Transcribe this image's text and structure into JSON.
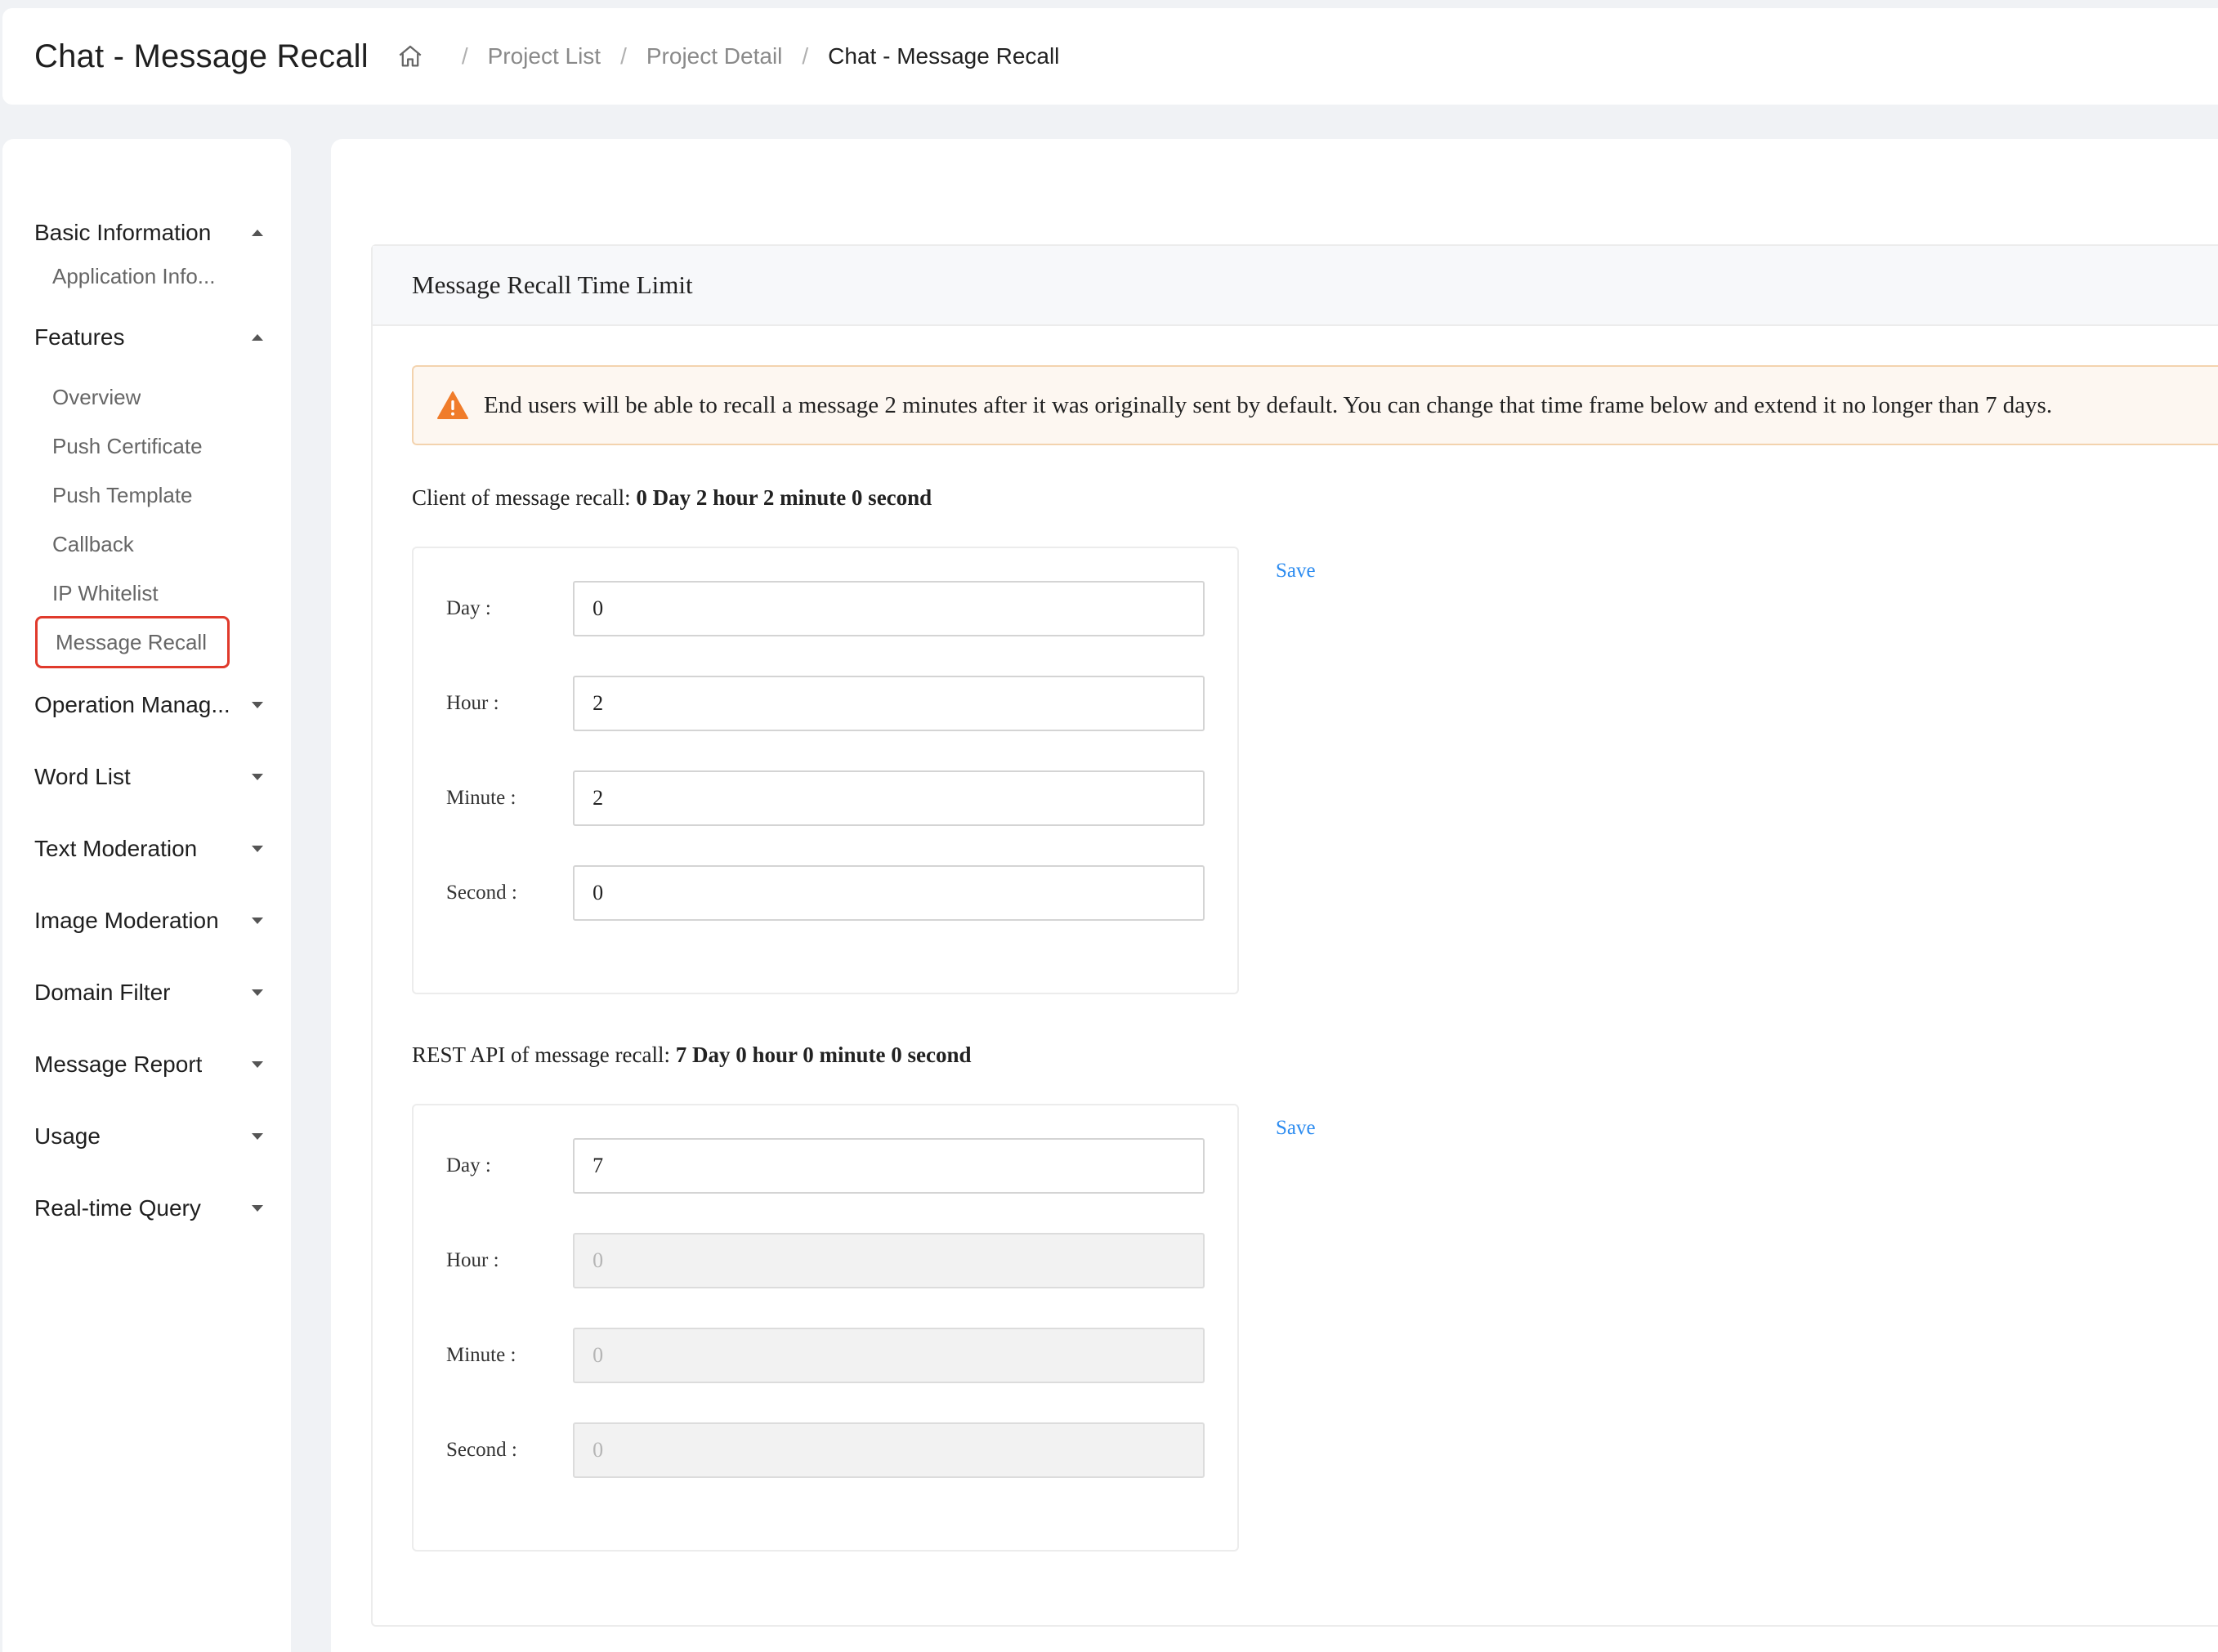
{
  "header": {
    "title": "Chat - Message Recall",
    "breadcrumb": [
      "Project List",
      "Project Detail",
      "Chat - Message Recall"
    ]
  },
  "sidebar": {
    "groups": [
      {
        "label": "Basic Information",
        "expanded": true,
        "items": [
          "Application Info..."
        ]
      },
      {
        "label": "Features",
        "expanded": true,
        "items": [
          "Overview",
          "Push Certificate",
          "Push Template",
          "Callback",
          "IP Whitelist",
          "Message Recall"
        ]
      },
      {
        "label": "Operation Manag...",
        "expanded": false
      },
      {
        "label": "Word List",
        "expanded": false
      },
      {
        "label": "Text Moderation",
        "expanded": false
      },
      {
        "label": "Image Moderation",
        "expanded": false
      },
      {
        "label": "Domain Filter",
        "expanded": false
      },
      {
        "label": "Message Report",
        "expanded": false
      },
      {
        "label": "Usage",
        "expanded": false
      },
      {
        "label": "Real-time Query",
        "expanded": false
      }
    ],
    "active_item": "Message Recall",
    "active_color": "#e03a2c"
  },
  "main": {
    "card_title": "Message Recall Time Limit",
    "alert_text": "End users will be able to recall a message 2 minutes after it was originally sent by default. You can change that time frame below and extend it no longer than 7 days.",
    "client": {
      "title_prefix": "Client of message recall:",
      "title_value": "0 Day 2 hour 2 minute 0 second",
      "save_label": "Save",
      "fields": [
        {
          "label": "Day :",
          "value": "0",
          "disabled": false
        },
        {
          "label": "Hour :",
          "value": "2",
          "disabled": false
        },
        {
          "label": "Minute :",
          "value": "2",
          "disabled": false
        },
        {
          "label": "Second :",
          "value": "0",
          "disabled": false
        }
      ]
    },
    "rest": {
      "title_prefix": "REST API of message recall:",
      "title_value": "7 Day 0 hour 0 minute 0 second",
      "save_label": "Save",
      "fields": [
        {
          "label": "Day :",
          "value": "7",
          "disabled": false
        },
        {
          "label": "Hour :",
          "value": "0",
          "disabled": true
        },
        {
          "label": "Minute :",
          "value": "0",
          "disabled": true
        },
        {
          "label": "Second :",
          "value": "0",
          "disabled": true
        }
      ]
    }
  },
  "colors": {
    "link": "#2d8cf0",
    "warning": "#f07c2a"
  }
}
